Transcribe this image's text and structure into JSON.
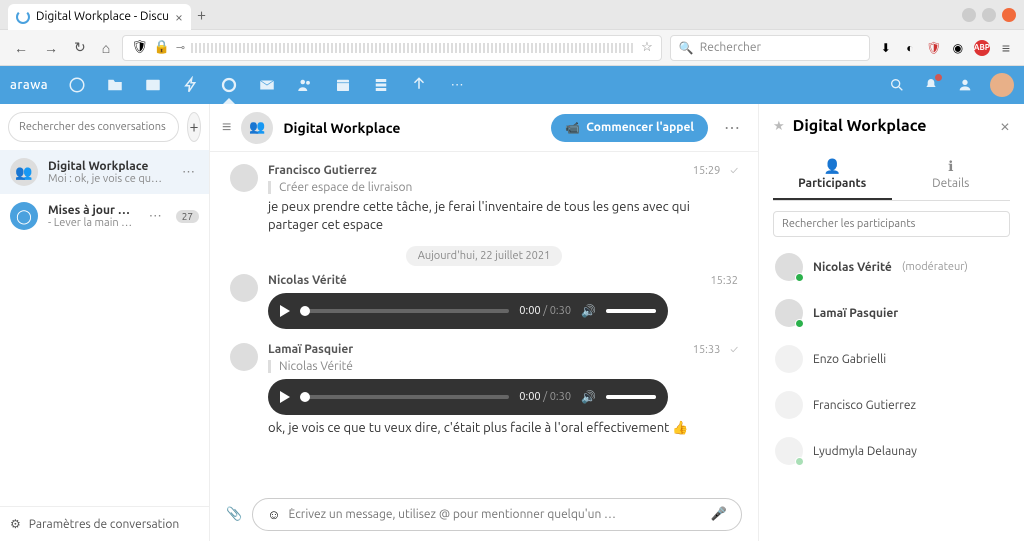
{
  "browser": {
    "tab_title": "Digital Workplace - Discu",
    "search_placeholder": "Rechercher"
  },
  "brand": "arawa",
  "sidebar": {
    "search_placeholder": "Rechercher des conversations ou des utilisateurs",
    "conversations": [
      {
        "title": "Digital Workplace",
        "sub": "Moi : ok, je vois ce que tu ve…"
      },
      {
        "title": "Mises à jour de Talk ✅",
        "sub": "- Lever la main lors d'u…",
        "badge": "27"
      }
    ],
    "footer": "Paramètres de conversation"
  },
  "chat": {
    "room_title": "Digital Workplace",
    "call_label": "Commencer l'appel",
    "date_separator": "Aujourd'hui, 22 juillet 2021",
    "messages": {
      "m1": {
        "author": "Francisco Gutierrez",
        "quote": "Créer espace de livraison",
        "text": "je peux prendre cette tâche, je ferai l'inventaire de tous les gens avec qui partager cet espace",
        "time": "15:29"
      },
      "m2": {
        "author": "Nicolas Vérité",
        "time": "15:32",
        "audio_cur": "0:00",
        "audio_dur": "/ 0:30"
      },
      "m3": {
        "author": "Lamaï Pasquier",
        "quote": "Nicolas Vérité",
        "text": "ok, je vois ce que tu veux dire, c'était plus facile à l'oral effectivement 👍",
        "time": "15:33",
        "audio_cur": "0:00",
        "audio_dur": "/ 0:30"
      }
    },
    "compose_placeholder": "Écrivez un message, utilisez @ pour mentionner quelqu'un …"
  },
  "panel": {
    "title": "Digital Workplace",
    "tabs": {
      "participants": "Participants",
      "details": "Details"
    },
    "search_placeholder": "Rechercher les participants",
    "participants": [
      {
        "name": "Nicolas Vérité",
        "mod": "(modérateur)",
        "online": true,
        "bold": true
      },
      {
        "name": "Lamaï Pasquier",
        "online": true,
        "bold": true
      },
      {
        "name": "Enzo Gabrielli",
        "faded": true
      },
      {
        "name": "Francisco Gutierrez",
        "faded": true
      },
      {
        "name": "Lyudmyla Delaunay",
        "online": true,
        "faded": true
      }
    ]
  }
}
